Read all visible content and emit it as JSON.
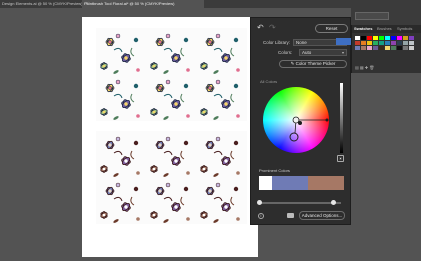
{
  "tabs": [
    {
      "label": "Design Elements.ai @ 50 % (CMYK/Preview)"
    },
    {
      "label": "Paintbrush Tool Floral.ai* @ 50 % (CMYK/Preview)"
    }
  ],
  "picker": {
    "reset_label": "Reset",
    "color_library_label": "Color Library:",
    "color_library_value": "None",
    "colors_label": "Colors:",
    "colors_value": "Auto",
    "theme_picker_label": "Color Theme Picker",
    "all_colors_label": "All Colors",
    "prominent_label": "Prominent Colors",
    "advanced_label": "Advanced Options...",
    "prominent_colors": [
      "#ffffff",
      "#6f7bb5",
      "#a67865"
    ]
  },
  "swatches_panel": {
    "tabs": [
      {
        "label": "Swatches",
        "active": true
      },
      {
        "label": "Brushes",
        "active": false
      },
      {
        "label": "Symbols",
        "active": false
      }
    ],
    "swatch_colors": [
      "#ffffff",
      "#000000",
      "#ff0000",
      "#ffff00",
      "#00ff00",
      "#00ffff",
      "#0000ff",
      "#ff00ff",
      "#d4a017",
      "#7f3fbf",
      "#c0392b",
      "#e67e22",
      "#f1c40f",
      "#27ae60",
      "#16a085",
      "#2980b9",
      "#8e44ad",
      "#2c3e50",
      "#95a5a6",
      "#bdc3c7",
      "#6f7bb5",
      "#a67865",
      "#e8a6c8",
      "#6b5b95",
      "#3b2a1a",
      "#f5d76e",
      "#4d7c5a",
      "#111111",
      "#777777",
      "#cccccc"
    ]
  },
  "colors": {
    "background": "#535353",
    "panel": "#2d2d2d"
  }
}
